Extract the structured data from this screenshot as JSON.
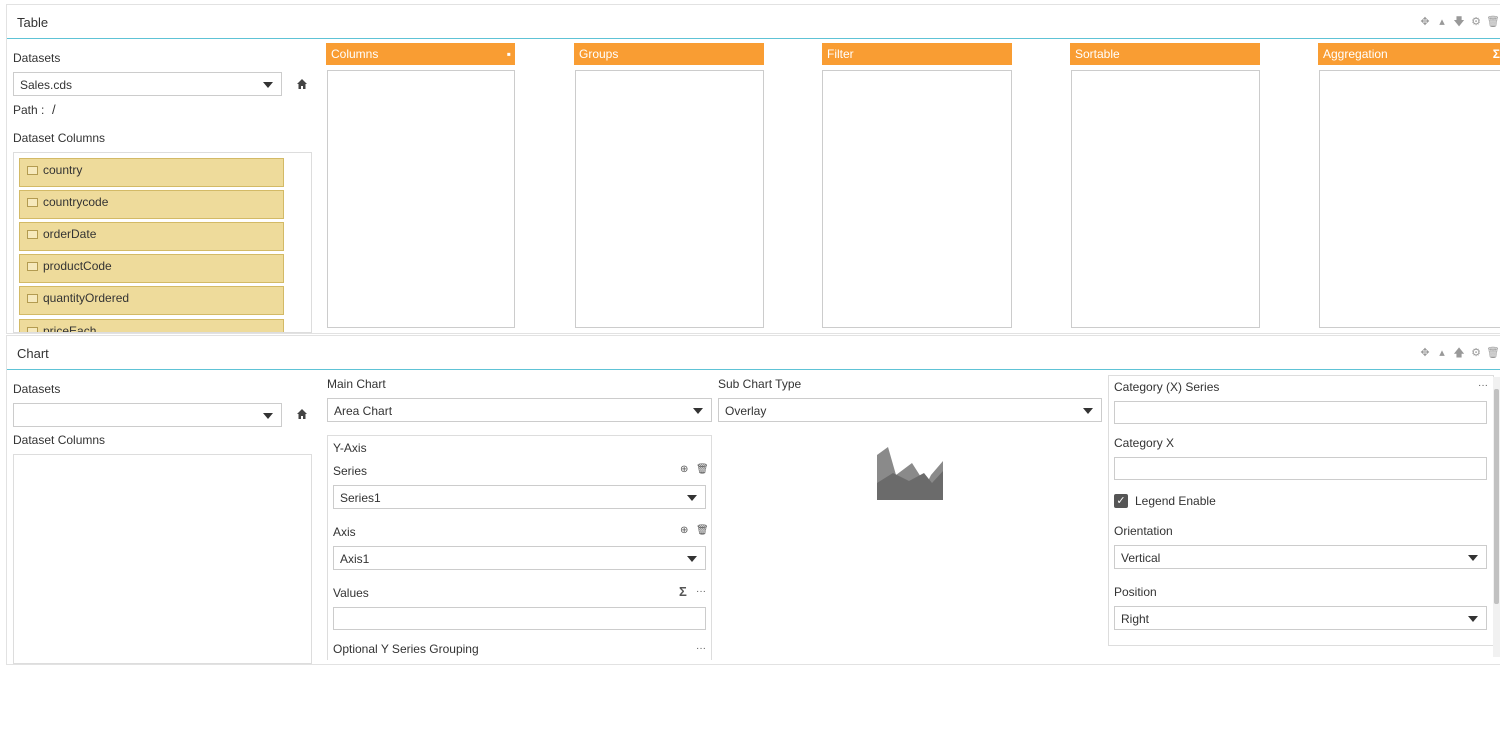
{
  "table_panel": {
    "title": "Table",
    "datasets_label": "Datasets",
    "dataset_selected": "Sales.cds",
    "path_label": "Path :",
    "path_value": "/",
    "dataset_columns_label": "Dataset Columns",
    "columns": [
      "country",
      "countrycode",
      "orderDate",
      "productCode",
      "quantityOrdered",
      "priceEach"
    ],
    "drop_zones": [
      {
        "label": "Columns",
        "icon": "comment-icon"
      },
      {
        "label": "Groups",
        "icon": ""
      },
      {
        "label": "Filter",
        "icon": ""
      },
      {
        "label": "Sortable",
        "icon": ""
      },
      {
        "label": "Aggregation",
        "icon": "sigma-icon"
      }
    ],
    "tools": [
      "move-icon",
      "caret-up-icon",
      "arrow-down-icon",
      "gear-icon",
      "trash-icon"
    ]
  },
  "chart_panel": {
    "title": "Chart",
    "datasets_label": "Datasets",
    "dataset_selected": "",
    "dataset_columns_label": "Dataset Columns",
    "main_chart_label": "Main Chart",
    "main_chart_value": "Area Chart",
    "sub_chart_label": "Sub Chart Type",
    "sub_chart_value": "Overlay",
    "y_axis": {
      "title": "Y-Axis",
      "series_label": "Series",
      "series_value": "Series1",
      "axis_label": "Axis",
      "axis_value": "Axis1",
      "values_label": "Values",
      "values_value": "",
      "grouping_label": "Optional Y Series Grouping"
    },
    "right": {
      "category_series_label": "Category (X) Series",
      "category_x_label": "Category X",
      "legend_label": "Legend Enable",
      "legend_checked": true,
      "orientation_label": "Orientation",
      "orientation_value": "Vertical",
      "position_label": "Position",
      "position_value": "Right"
    },
    "tools": [
      "move-icon",
      "caret-up-icon",
      "arrow-up-icon",
      "gear-icon",
      "trash-icon"
    ],
    "colors": {
      "accent_orange": "#f99d33",
      "header_line": "#5ec3d6",
      "column_item": "#eedb9b"
    }
  }
}
